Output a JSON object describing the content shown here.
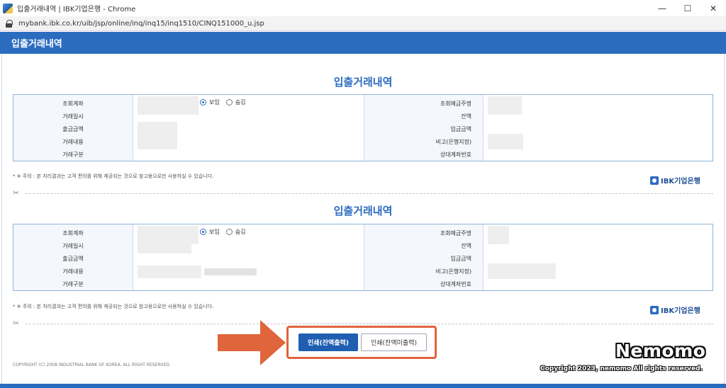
{
  "window": {
    "title": "입출거래내역 | IBK기업은행 - Chrome",
    "minimize": "—",
    "maximize": "☐",
    "close": "✕"
  },
  "url": "mybank.ibk.co.kr/uib/jsp/online/inq/inq15/inq1510/CINQ151000_u.jsp",
  "header": {
    "title": "입출거래내역"
  },
  "sections": [
    {
      "title": "입출거래내역",
      "left_labels": [
        "조회계좌",
        "거래일시",
        "출금금액",
        "거래내용",
        "거래구분"
      ],
      "right_labels": [
        "조회예금주명",
        "잔액",
        "입금금액",
        "비고(은행지정)",
        "상대계좌번호"
      ],
      "radio_options": [
        "보임",
        "숨김"
      ],
      "radio_selected": "보임",
      "notice": "* ※ 주의 : 본 처리결과는 고객 편의를 위해 제공되는 것으로 참고용으로만 사용하실 수 있습니다.",
      "logo_text": "IBK기업은행"
    },
    {
      "title": "입출거래내역",
      "left_labels": [
        "조회계좌",
        "거래일시",
        "출금금액",
        "거래내용",
        "거래구분"
      ],
      "right_labels": [
        "조회예금주명",
        "잔액",
        "입금금액",
        "비고(은행지정)",
        "상대계좌번호"
      ],
      "radio_options": [
        "보임",
        "숨김"
      ],
      "radio_selected": "보임",
      "notice": "* ※ 주의 : 본 처리결과는 고객 편의를 위해 제공되는 것으로 참고용으로만 사용하실 수 있습니다.",
      "logo_text": "IBK기업은행"
    }
  ],
  "buttons": {
    "print_with_balance": "인쇄(잔액출력)",
    "print_without_balance": "인쇄(잔액미출력)"
  },
  "footer": {
    "copyright": "COPYRIGHT (C) 2008 INDUSTRIAL BANK OF KOREA. ALL RIGHT RESERVED."
  },
  "watermark": {
    "title": "Nemomo",
    "subtitle": "Copyright 2023, nemomo All rights reserved."
  },
  "icons": [
    "app-icon",
    "lock-icon",
    "scissors-icon",
    "ibk-logo-icon",
    "arrow-icon"
  ],
  "colors": {
    "brand_blue": "#2c6cbf",
    "highlight_orange": "#e0643c"
  }
}
